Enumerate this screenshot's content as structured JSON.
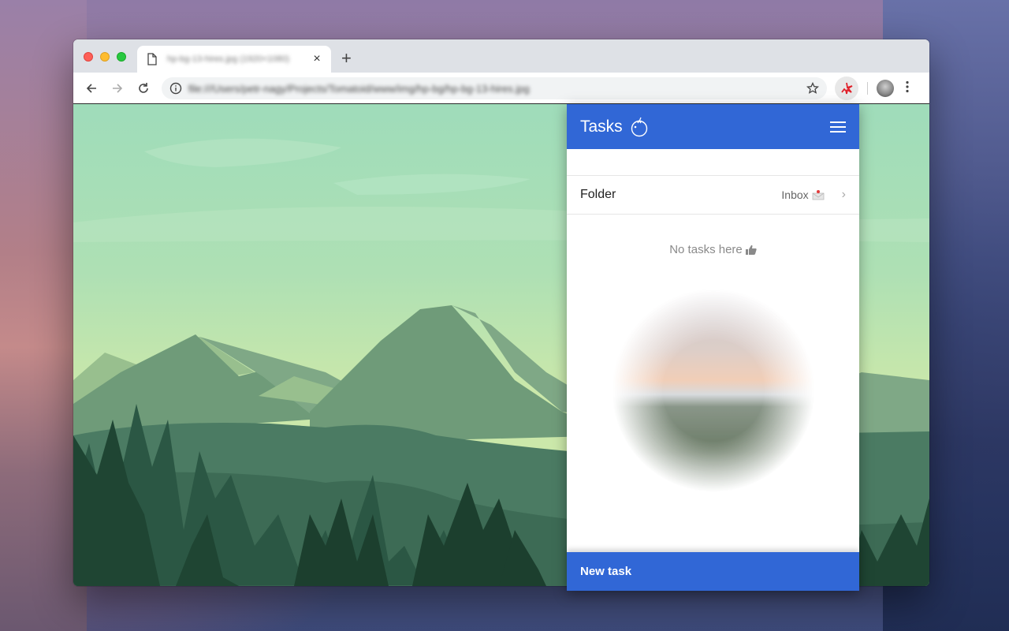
{
  "browser": {
    "tab": {
      "title": "hp-bg-13-hires.jpg (1920×1080)",
      "close_label": "×"
    },
    "new_tab_label": "+",
    "omnibox": {
      "url": "file:///Users/petr-nagy/Projects/Tomatoid/www/img/hp-bg/hp-bg-13-hires.jpg"
    },
    "icons": {
      "back": "arrow-left",
      "forward": "arrow-right",
      "reload": "reload",
      "site_info": "info-circle",
      "bookmark": "star-outline",
      "extension": "tomatoid-extension",
      "profile": "avatar",
      "menu": "vertical-dots"
    }
  },
  "popup": {
    "title": "Tasks",
    "header_icon": "tomato",
    "menu_icon": "hamburger",
    "folder_row": {
      "label": "Folder",
      "value": "Inbox",
      "value_icon": "envelope-inbox",
      "chevron": "›"
    },
    "empty_state": {
      "text": "No tasks here",
      "icon": "thumbs-up"
    },
    "new_task_label": "New task"
  },
  "colors": {
    "accent": "#3167d6",
    "tab_bar": "#dee1e6",
    "empty_text": "#8a8a8a"
  }
}
